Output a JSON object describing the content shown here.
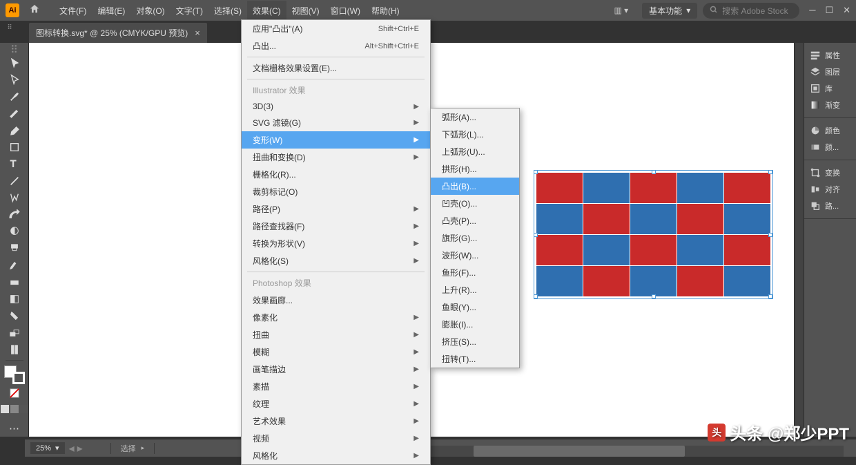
{
  "app": {
    "logo_text": "Ai"
  },
  "menubar": [
    "文件(F)",
    "编辑(E)",
    "对象(O)",
    "文字(T)",
    "选择(S)",
    "效果(C)",
    "视图(V)",
    "窗口(W)",
    "帮助(H)"
  ],
  "workspace": "基本功能",
  "search": {
    "placeholder": "搜索 Adobe Stock"
  },
  "document_tab": {
    "title": "图标转换.svg* @ 25% (CMYK/GPU 预览)"
  },
  "effects_menu": {
    "top": [
      {
        "label": "应用\"凸出\"(A)",
        "shortcut": "Shift+Ctrl+E"
      },
      {
        "label": "凸出...",
        "shortcut": "Alt+Shift+Ctrl+E"
      }
    ],
    "doc_raster": "文档栅格效果设置(E)...",
    "header1": "Illustrator 效果",
    "ill": [
      {
        "label": "3D(3)",
        "sub": true
      },
      {
        "label": "SVG 滤镜(G)",
        "sub": true
      },
      {
        "label": "变形(W)",
        "sub": true,
        "hl": true
      },
      {
        "label": "扭曲和变换(D)",
        "sub": true
      },
      {
        "label": "栅格化(R)..."
      },
      {
        "label": "裁剪标记(O)"
      },
      {
        "label": "路径(P)",
        "sub": true
      },
      {
        "label": "路径查找器(F)",
        "sub": true
      },
      {
        "label": "转换为形状(V)",
        "sub": true
      },
      {
        "label": "风格化(S)",
        "sub": true
      }
    ],
    "header2": "Photoshop 效果",
    "ps": [
      {
        "label": "效果画廊..."
      },
      {
        "label": "像素化",
        "sub": true
      },
      {
        "label": "扭曲",
        "sub": true
      },
      {
        "label": "模糊",
        "sub": true
      },
      {
        "label": "画笔描边",
        "sub": true
      },
      {
        "label": "素描",
        "sub": true
      },
      {
        "label": "纹理",
        "sub": true
      },
      {
        "label": "艺术效果",
        "sub": true
      },
      {
        "label": "视频",
        "sub": true
      },
      {
        "label": "风格化",
        "sub": true
      }
    ]
  },
  "warp_submenu": [
    {
      "label": "弧形(A)..."
    },
    {
      "label": "下弧形(L)..."
    },
    {
      "label": "上弧形(U)..."
    },
    {
      "label": "拱形(H)..."
    },
    {
      "label": "凸出(B)...",
      "hl": true
    },
    {
      "label": "凹壳(O)..."
    },
    {
      "label": "凸壳(P)..."
    },
    {
      "label": "旗形(G)..."
    },
    {
      "label": "波形(W)..."
    },
    {
      "label": "鱼形(F)..."
    },
    {
      "label": "上升(R)..."
    },
    {
      "label": "鱼眼(Y)..."
    },
    {
      "label": "膨胀(I)..."
    },
    {
      "label": "挤压(S)..."
    },
    {
      "label": "扭转(T)..."
    }
  ],
  "right_panels": {
    "g1": [
      "属性",
      "图层",
      "库",
      "渐变"
    ],
    "g2": [
      "颜色",
      "颜..."
    ],
    "g3": [
      "变换",
      "对齐",
      "路..."
    ]
  },
  "status": {
    "zoom": "25%",
    "mode": "选择"
  },
  "watermark": "头条 @郑少PPT",
  "grid_pattern": [
    [
      "r",
      "b",
      "r",
      "b",
      "r"
    ],
    [
      "b",
      "r",
      "b",
      "r",
      "b"
    ],
    [
      "r",
      "b",
      "r",
      "b",
      "r"
    ],
    [
      "b",
      "r",
      "b",
      "r",
      "b"
    ]
  ]
}
